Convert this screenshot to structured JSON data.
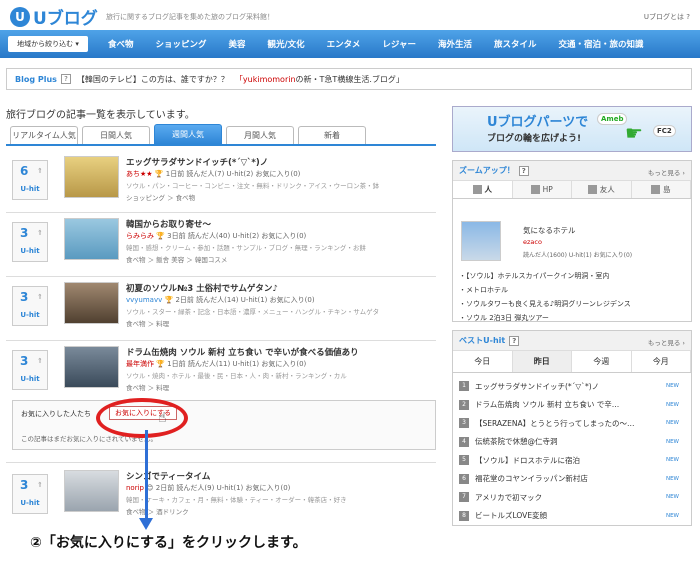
{
  "header": {
    "logo_mark": "U",
    "logo_text": "Uブログ",
    "tagline": "旅行に関するブログ記事を集めた旅のブログ采料館！",
    "whatis": "Uブログとは ?"
  },
  "nav": {
    "area_select": "地域から絞り込む ▾",
    "items": [
      "食べ物",
      "ショッピング",
      "美容",
      "観光/文化",
      "エンタメ",
      "レジャー",
      "海外生活",
      "旅スタイル",
      "交通・宿泊・旅の知識"
    ]
  },
  "blogplus": {
    "label": "Blog Plus",
    "help": "?",
    "text": "【韓国のテレビ】この方は、誰ですか？？",
    "user": "「yukimomorin",
    "text2": "の新・T急T横線生活.ブログ」"
  },
  "section_title": "旅行ブログの記事一覧を表示しています。",
  "tabs": [
    "リアルタイム人気",
    "日間人気",
    "週間人気",
    "月間人気",
    "新着"
  ],
  "active_tab": 2,
  "entries": [
    {
      "rank": "6",
      "arrow": "⇑",
      "uhit": "U-hit",
      "title": "エッグサラダサンドイッチ(*´▽`*)ノ",
      "author": "あち★★",
      "meta": "🏆 1日前 読んだ人(7) U-hit(2) お気に入り(0)",
      "tags": "ソウル・パン・コーヒー・コンビニ・注文・無料・ドリンク・アイス・ウーロン茶・鉢",
      "cat": "ショッピング ＞ 食べ物"
    },
    {
      "rank": "3",
      "arrow": "⇑",
      "uhit": "U-hit",
      "title": "韓国からお取り寄せ〜",
      "author": "らみらみ",
      "meta": "🏆 3日前 読んだ人(40) U-hit(2) お気に入り(0)",
      "tags": "韓国・感想・クリーム・参加・話題・サンプル・ブログ・無理・ランキング・お餅",
      "cat": "食べ物 ＞ 飯舎  美容 ＞ 韓国コスメ"
    },
    {
      "rank": "3",
      "arrow": "⇑",
      "uhit": "U-hit",
      "title": "初夏のソウル№3 土俗村でサムゲタン♪",
      "author": "vvyumavv",
      "meta": "🏆 2日前 読んだ人(14) U-hit(1) お気に入り(0)",
      "tags": "ソウル・スター・緑茶・記念・日本語・濃厚・メニュー・ハングル・チキン・サムゲタ",
      "cat": "食べ物 ＞ 料理"
    },
    {
      "rank": "3",
      "arrow": "⇑",
      "uhit": "U-hit",
      "title": "ドラム缶焼肉 ソウル 新村 立ち食い で辛いが食べる価値あり",
      "author": "最年満作",
      "meta": "🏆 1日前 読んだ人(11) U-hit(1) お気に入り(0)",
      "tags": "ソウル・焼肉・ホテル・最後・民・日本・人・肉・新村・ランキング・カル",
      "cat": "食べ物 ＞ 料理"
    },
    {
      "rank": "3",
      "arrow": "⇑",
      "uhit": "U-hit",
      "title": "シンゴでティータイム",
      "author": "norip",
      "meta": "😊 2日前 読んだ人(9) U-hit(1) お気に入り(0)",
      "tags": "韓国・ケーキ・カフェ・月・無料・体験・ティー・オーダー・韓茶店・好き",
      "cat": "食べ物 ＞ 酒ドリンク"
    }
  ],
  "fav": {
    "label": "お気に入りした人たち",
    "button": "お気に入りにする",
    "empty": "この記事はまだお気に入りにされていません。"
  },
  "instruction": "②「お気に入りにする」をクリックします。",
  "banner": {
    "line1": "Uブログパーツで",
    "line2": "ブログの輪を広げよう!",
    "ameba": "Ameb",
    "fc2": "FC2"
  },
  "zoom": {
    "title": "ズームアップ！",
    "help": "?",
    "more": "もっと見る ›",
    "tabs": [
      "人",
      "HP",
      "友人",
      "島"
    ],
    "name": "気になるホテル",
    "author": "ezaco",
    "stats": "読んだ人(1600) U-hit(1) お気に入り(0)",
    "list": [
      "・【ソウル】ホテルスカイパークイン明洞・室内",
      "・メトロホテル",
      "・ソウルタワーも良く見える♪明洞グリーンレジデンス",
      "・ソウル 2泊3日 弾丸ツアー"
    ]
  },
  "best": {
    "title": "ベストU-hit",
    "help": "?",
    "more": "もっと見る ›",
    "tabs": [
      "今日",
      "昨日",
      "今週",
      "今月"
    ],
    "active": 1,
    "items": [
      {
        "n": "1",
        "t": "エッグサラダサンドイッチ(*´▽`*)ノ",
        "new": "NEW"
      },
      {
        "n": "2",
        "t": "ドラム缶焼肉 ソウル 新村 立ち食い で辛…",
        "new": "NEW"
      },
      {
        "n": "3",
        "t": "【SERAZENA】とうとう行ってしまったの〜…",
        "new": "NEW"
      },
      {
        "n": "4",
        "t": "伝統茶院で休憩@仁寺洞",
        "new": "NEW"
      },
      {
        "n": "5",
        "t": "【ソウル】ドロスホテルに宿泊",
        "new": "NEW"
      },
      {
        "n": "6",
        "t": "福花堂のコヤンイラッパン新村店",
        "new": "NEW"
      },
      {
        "n": "7",
        "t": "アメリカで初マック",
        "new": "NEW"
      },
      {
        "n": "8",
        "t": "ビートルズLOVE変顔",
        "new": "NEW"
      }
    ]
  }
}
